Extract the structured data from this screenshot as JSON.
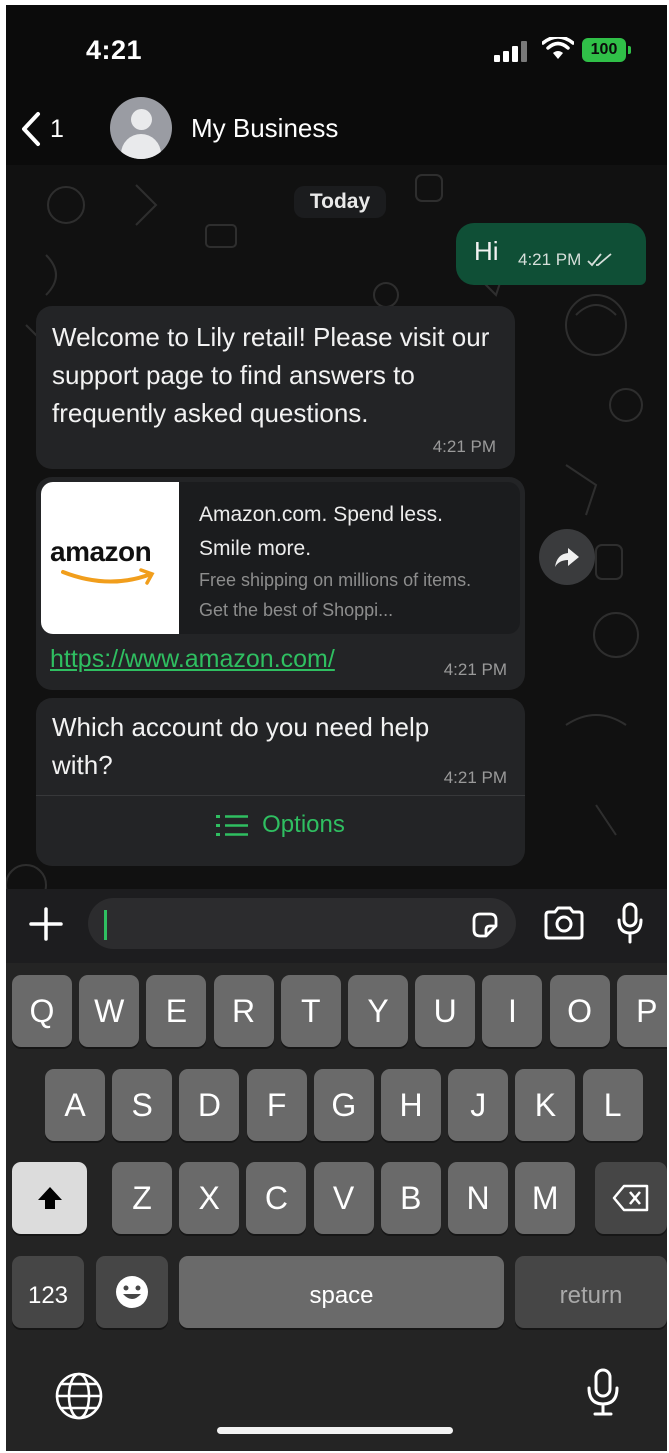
{
  "status_bar": {
    "time": "4:21",
    "battery": "100",
    "battery_color": "#30c048"
  },
  "nav": {
    "back_count": "1",
    "title": "My Business"
  },
  "chat": {
    "date_chip": "Today",
    "messages": [
      {
        "direction": "out",
        "text": "Hi",
        "time": "4:21 PM",
        "status": "read"
      },
      {
        "direction": "in",
        "text": "Welcome to Lily retail! Please visit our support page to find answers to frequently asked questions.",
        "time": "4:21 PM"
      },
      {
        "direction": "in",
        "preview_logo": "amazon",
        "preview_title": "Amazon.com. Spend less. Smile more.",
        "preview_desc": "Free shipping on millions of items. Get the best of Shoppi...",
        "link": "https://www.amazon.com/",
        "time": "4:21 PM"
      },
      {
        "direction": "in",
        "text": "Which account do you need help with?",
        "time": "4:21 PM",
        "button": "Options"
      }
    ]
  },
  "keyboard": {
    "row1": [
      "Q",
      "W",
      "E",
      "R",
      "T",
      "Y",
      "U",
      "I",
      "O",
      "P"
    ],
    "row2": [
      "A",
      "S",
      "D",
      "F",
      "G",
      "H",
      "J",
      "K",
      "L"
    ],
    "row3": [
      "Z",
      "X",
      "C",
      "V",
      "B",
      "N",
      "M"
    ],
    "num_key": "123",
    "space_key": "space",
    "return_key": "return"
  },
  "colors": {
    "accent": "#2fbf61",
    "outgoing_bubble": "#0f4f36",
    "incoming_bubble": "#232426",
    "background": "#0b0b0b"
  }
}
